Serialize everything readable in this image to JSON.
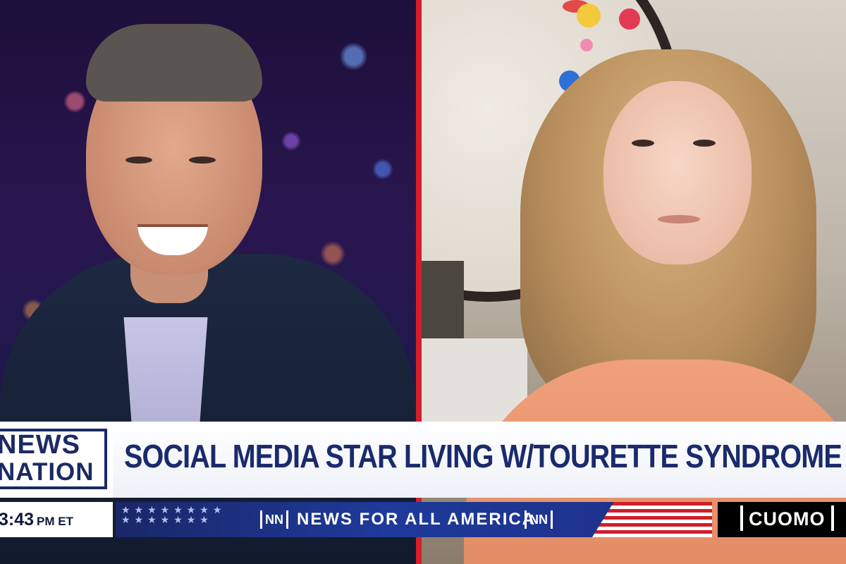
{
  "network_logo": {
    "line1": "NEWS",
    "line2": "NATION"
  },
  "headline": "SOCIAL MEDIA STAR LIVING W/TOURETTE SYNDROME",
  "clock": {
    "time": "3:43",
    "suffix": "PM ET"
  },
  "ticker": {
    "mark_left": "NN",
    "text": "NEWS FOR ALL AMERICA",
    "mark_right": "NN"
  },
  "show_badge": "CUOMO",
  "colors": {
    "navy": "#1a2a6c",
    "ticker_blue": "#1e3a9a",
    "divider_red": "#d21f2a",
    "badge_black": "#000000"
  }
}
